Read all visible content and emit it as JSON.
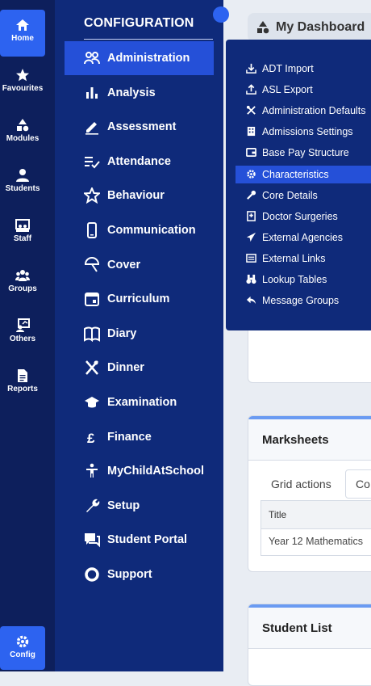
{
  "rail": {
    "items": [
      {
        "label": "Home",
        "icon": "home-icon"
      },
      {
        "label": "Favourites",
        "icon": "star-icon"
      },
      {
        "label": "Modules",
        "icon": "shapes-icon"
      },
      {
        "label": "Students",
        "icon": "user-icon"
      },
      {
        "label": "Staff",
        "icon": "staff-icon"
      },
      {
        "label": "Groups",
        "icon": "group-icon"
      },
      {
        "label": "Others",
        "icon": "others-icon"
      },
      {
        "label": "Reports",
        "icon": "report-icon"
      }
    ],
    "config_label": "Config"
  },
  "menu": {
    "title": "CONFIGURATION",
    "items": [
      {
        "label": "Administration",
        "icon": "admin-icon"
      },
      {
        "label": "Analysis",
        "icon": "bar-chart-icon"
      },
      {
        "label": "Assessment",
        "icon": "pencil-icon"
      },
      {
        "label": "Attendance",
        "icon": "checklist-icon"
      },
      {
        "label": "Behaviour",
        "icon": "star-outline-icon"
      },
      {
        "label": "Communication",
        "icon": "phone-icon"
      },
      {
        "label": "Cover",
        "icon": "cover-icon"
      },
      {
        "label": "Curriculum",
        "icon": "calendar-icon"
      },
      {
        "label": "Diary",
        "icon": "book-icon"
      },
      {
        "label": "Dinner",
        "icon": "cutlery-icon"
      },
      {
        "label": "Examination",
        "icon": "graduation-cap-icon"
      },
      {
        "label": "Finance",
        "icon": "pound-icon"
      },
      {
        "label": "MyChildAtSchool",
        "icon": "person-icon"
      },
      {
        "label": "Setup",
        "icon": "wrench-icon"
      },
      {
        "label": "Student Portal",
        "icon": "chat-icon"
      },
      {
        "label": "Support",
        "icon": "circle-icon"
      }
    ]
  },
  "submenu": {
    "items": [
      {
        "label": "ADT Import",
        "icon": "download-icon"
      },
      {
        "label": "ASL Export",
        "icon": "upload-icon"
      },
      {
        "label": "Administration Defaults",
        "icon": "tools-icon"
      },
      {
        "label": "Admissions Settings",
        "icon": "building-icon"
      },
      {
        "label": "Base Pay Structure",
        "icon": "wallet-icon"
      },
      {
        "label": "Characteristics",
        "icon": "gear-icon"
      },
      {
        "label": "Core Details",
        "icon": "tool-icon"
      },
      {
        "label": "Doctor Surgeries",
        "icon": "hospital-icon"
      },
      {
        "label": "External Agencies",
        "icon": "send-icon"
      },
      {
        "label": "External Links",
        "icon": "list-icon"
      },
      {
        "label": "Lookup Tables",
        "icon": "binoculars-icon"
      },
      {
        "label": "Message Groups",
        "icon": "reply-icon"
      }
    ]
  },
  "main": {
    "dashboard_label": "My Dashboard",
    "marksheets_title": "Marksheets",
    "grid_actions": "Grid actions",
    "co_button": "Co",
    "table_header": "Title",
    "table_row": "Year 12 Mathematics",
    "student_list_title": "Student List"
  },
  "colors": {
    "rail": "#0d1f5c",
    "menu": "#0f2a7a",
    "active": "#2550d8",
    "rail_active": "#2d63f0"
  }
}
